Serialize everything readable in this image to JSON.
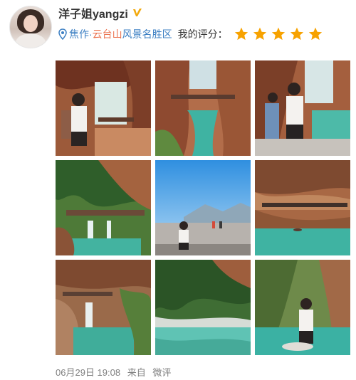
{
  "user": {
    "name": "洋子姐yangzi",
    "avatar_icon": "avatar-photo",
    "verified_icon": "verified-v-icon",
    "verified_color": "#f2a90d"
  },
  "location": {
    "icon": "location-pin-icon",
    "city": "焦作",
    "separator": "·",
    "place_link": "云台山",
    "place_rest": "风景名胜区",
    "rating_label": "我的评分：",
    "rating_stars": 5,
    "rating_max": 5,
    "star_color": "#f7a200",
    "link_color": "#eb7350",
    "city_color": "#3c7fc3"
  },
  "photos": [
    "canyon-cave-woman-white-shirt",
    "canyon-bridge-river",
    "canyon-walkway-tourists",
    "waterfall-green-pool",
    "mountain-viewpoint-blue-sky",
    "red-cliff-turquoise-river",
    "waterfall-rocks-pool",
    "turquoise-stream-trees",
    "woman-by-green-pool"
  ],
  "meta": {
    "date": "06月29日 19:08",
    "source_prefix": "来自",
    "source": "微评"
  }
}
